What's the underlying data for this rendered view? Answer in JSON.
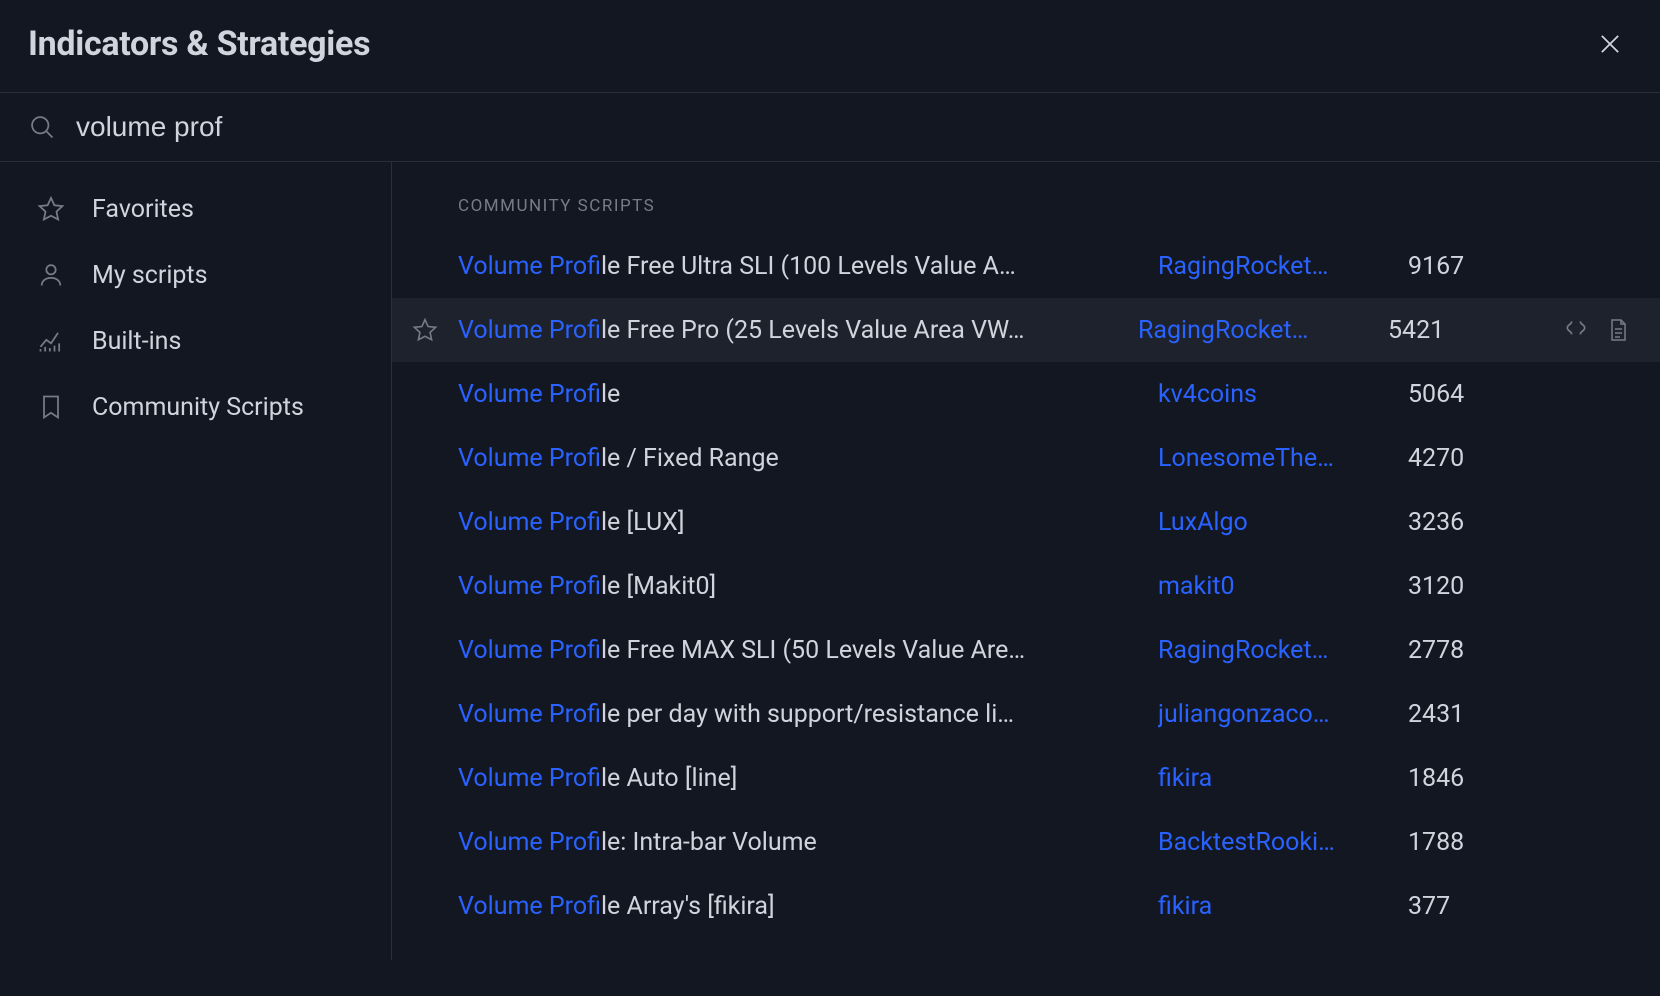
{
  "header": {
    "title": "Indicators & Strategies"
  },
  "search": {
    "value": "volume prof"
  },
  "sidebar": {
    "items": [
      {
        "icon": "star",
        "label": "Favorites"
      },
      {
        "icon": "user",
        "label": "My scripts"
      },
      {
        "icon": "chart",
        "label": "Built-ins"
      },
      {
        "icon": "bookmark",
        "label": "Community Scripts"
      }
    ]
  },
  "section": {
    "heading": "COMMUNITY SCRIPTS"
  },
  "results": [
    {
      "highlight": "Volume Prof",
      "rest": "ile Free Ultra SLI (100 Levels Value A…",
      "author": "RagingRocket…",
      "count": "9167",
      "hovered": false
    },
    {
      "highlight": "Volume Prof",
      "rest": "ile Free Pro (25 Levels Value Area VW…",
      "author": "RagingRocket…",
      "count": "5421",
      "hovered": true
    },
    {
      "highlight": "Volume Prof",
      "rest": "ile",
      "author": "kv4coins",
      "count": "5064",
      "hovered": false
    },
    {
      "highlight": "Volume Prof",
      "rest": "ile / Fixed Range",
      "author": "LonesomeThe…",
      "count": "4270",
      "hovered": false
    },
    {
      "highlight": "Volume Prof",
      "rest": "ile [LUX]",
      "author": "LuxAlgo",
      "count": "3236",
      "hovered": false
    },
    {
      "highlight": "Volume Prof",
      "rest": "ile [Makit0]",
      "author": "makit0",
      "count": "3120",
      "hovered": false
    },
    {
      "highlight": "Volume Prof",
      "rest": "ile Free MAX SLI (50 Levels Value Are…",
      "author": "RagingRocket…",
      "count": "2778",
      "hovered": false
    },
    {
      "highlight": "Volume Prof",
      "rest": "ile per day with support/resistance li…",
      "author": "juliangonzaco…",
      "count": "2431",
      "hovered": false
    },
    {
      "highlight": "Volume Prof",
      "rest": "ile Auto [line]",
      "author": "fikira",
      "count": "1846",
      "hovered": false
    },
    {
      "highlight": "Volume Prof",
      "rest": "ile: Intra-bar Volume",
      "author": "BacktestRooki…",
      "count": "1788",
      "hovered": false
    },
    {
      "highlight": "Volume Prof",
      "rest": "ile Array's [fikira]",
      "author": "fikira",
      "count": "377",
      "hovered": false
    }
  ]
}
